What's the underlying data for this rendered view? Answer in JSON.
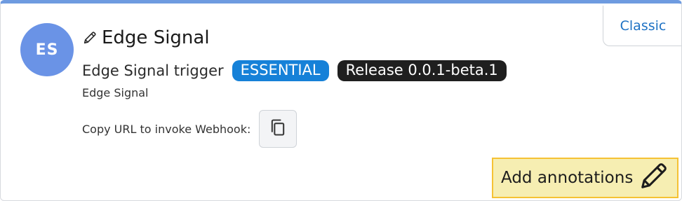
{
  "app": {
    "avatar_initials": "ES",
    "title": "Edge Signal",
    "trigger_label": "Edge Signal trigger",
    "badge_essential": "ESSENTIAL",
    "badge_release": "Release 0.0.1-beta.1",
    "caption": "Edge Signal",
    "webhook_label": "Copy URL to invoke Webhook:",
    "classic_tab": "Classic",
    "annotations_button": "Add annotations"
  },
  "icons": {
    "title": "pencil-icon",
    "copy": "copy-icon",
    "annotations": "pencil-icon"
  },
  "colors": {
    "top_accent": "#6e9be0",
    "avatar_bg": "#6a93e6",
    "essential_badge": "#1681d8",
    "release_badge": "#1f1f1f",
    "classic_link": "#1e72c4",
    "annotation_bg": "#f6eeb2",
    "annotation_border": "#f5c234"
  }
}
